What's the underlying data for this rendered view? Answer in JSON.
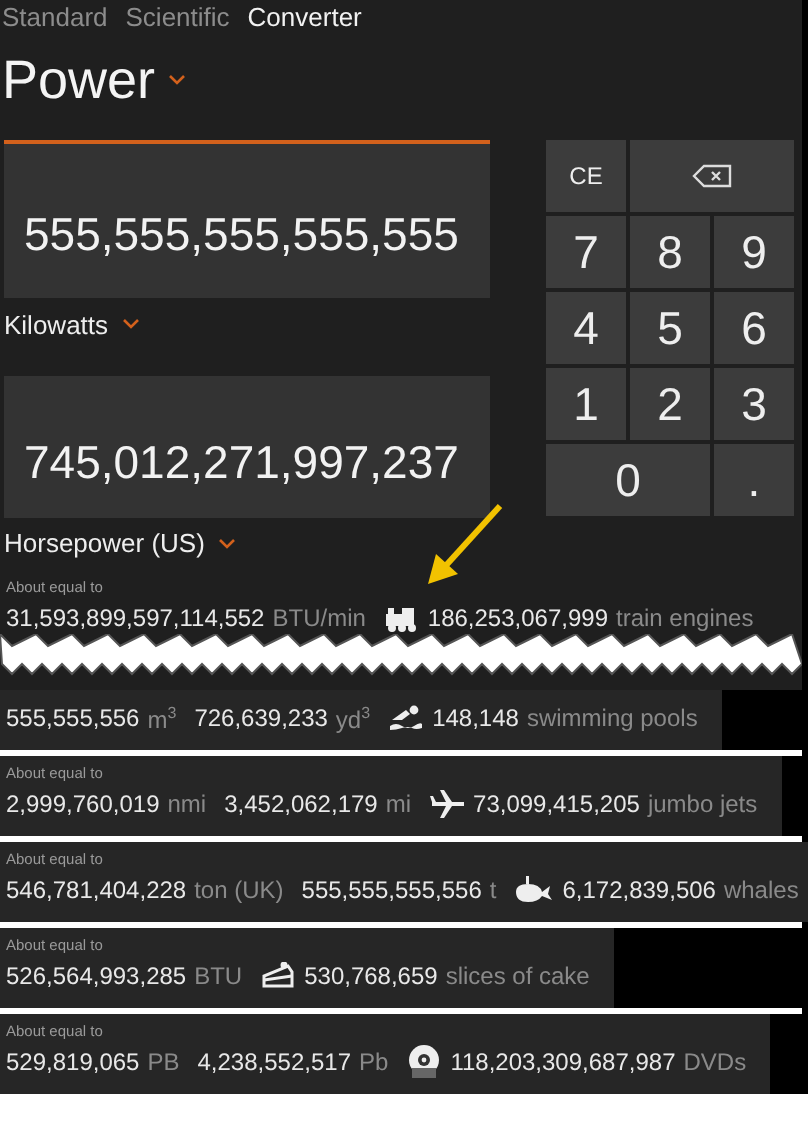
{
  "tabs": [
    {
      "label": "Standard",
      "selected": false
    },
    {
      "label": "Scientific",
      "selected": false
    },
    {
      "label": "Converter",
      "selected": true
    }
  ],
  "category": "Power",
  "input": {
    "value": "555,555,555,555,555",
    "unit": "Kilowatts",
    "active": true
  },
  "output": {
    "value": "745,012,271,997,237",
    "unit": "Horsepower (US)",
    "active": false
  },
  "keypad": [
    {
      "kind": "text",
      "label": "CE",
      "wide": false
    },
    {
      "kind": "backspace",
      "wide": true
    },
    {
      "kind": "digit",
      "label": "7",
      "wide": false
    },
    {
      "kind": "digit",
      "label": "8",
      "wide": false
    },
    {
      "kind": "digit",
      "label": "9",
      "wide": false
    },
    {
      "kind": "digit",
      "label": "4",
      "wide": false
    },
    {
      "kind": "digit",
      "label": "5",
      "wide": false
    },
    {
      "kind": "digit",
      "label": "6",
      "wide": false
    },
    {
      "kind": "digit",
      "label": "1",
      "wide": false
    },
    {
      "kind": "digit",
      "label": "2",
      "wide": false
    },
    {
      "kind": "digit",
      "label": "3",
      "wide": false
    },
    {
      "kind": "digit",
      "label": "0",
      "wide": true
    },
    {
      "kind": "digit",
      "label": ".",
      "wide": false
    }
  ],
  "equivalents": [
    {
      "label": "About equal to",
      "items": [
        {
          "value": "31,593,899,597,114,552",
          "unit": "BTU/min"
        },
        {
          "kind": "train",
          "value": "186,253,067,999",
          "unit": "train engines"
        }
      ]
    },
    {
      "items": [
        {
          "value": "555,555,556",
          "unit": "m$^{3}$"
        },
        {
          "value": "726,639,233",
          "unit": "yd$^{3}$"
        },
        {
          "kind": "swimmer",
          "value": "148,148",
          "unit": "swimming pools"
        }
      ]
    },
    {
      "label": "About equal to",
      "items": [
        {
          "value": "2,999,760,019",
          "unit": "nmi"
        },
        {
          "value": "3,452,062,179",
          "unit": "mi"
        },
        {
          "kind": "plane",
          "value": "73,099,415,205",
          "unit": "jumbo jets"
        }
      ]
    },
    {
      "label": "About equal to",
      "items": [
        {
          "value": "546,781,404,228",
          "unit": "ton (UK)"
        },
        {
          "value": "555,555,555,556",
          "unit": "t"
        },
        {
          "kind": "whale",
          "value": "6,172,839,506",
          "unit": "whales"
        }
      ]
    },
    {
      "label": "About equal to",
      "items": [
        {
          "value": "526,564,993,285",
          "unit": "BTU"
        },
        {
          "kind": "cake",
          "value": "530,768,659",
          "unit": "slices of cake"
        }
      ]
    },
    {
      "label": "About equal to",
      "items": [
        {
          "value": "529,819,065",
          "unit": "PB"
        },
        {
          "value": "4,238,552,517",
          "unit": "Pb"
        },
        {
          "kind": "disc",
          "value": "118,203,309,687,987",
          "unit": "DVDs"
        }
      ]
    }
  ]
}
